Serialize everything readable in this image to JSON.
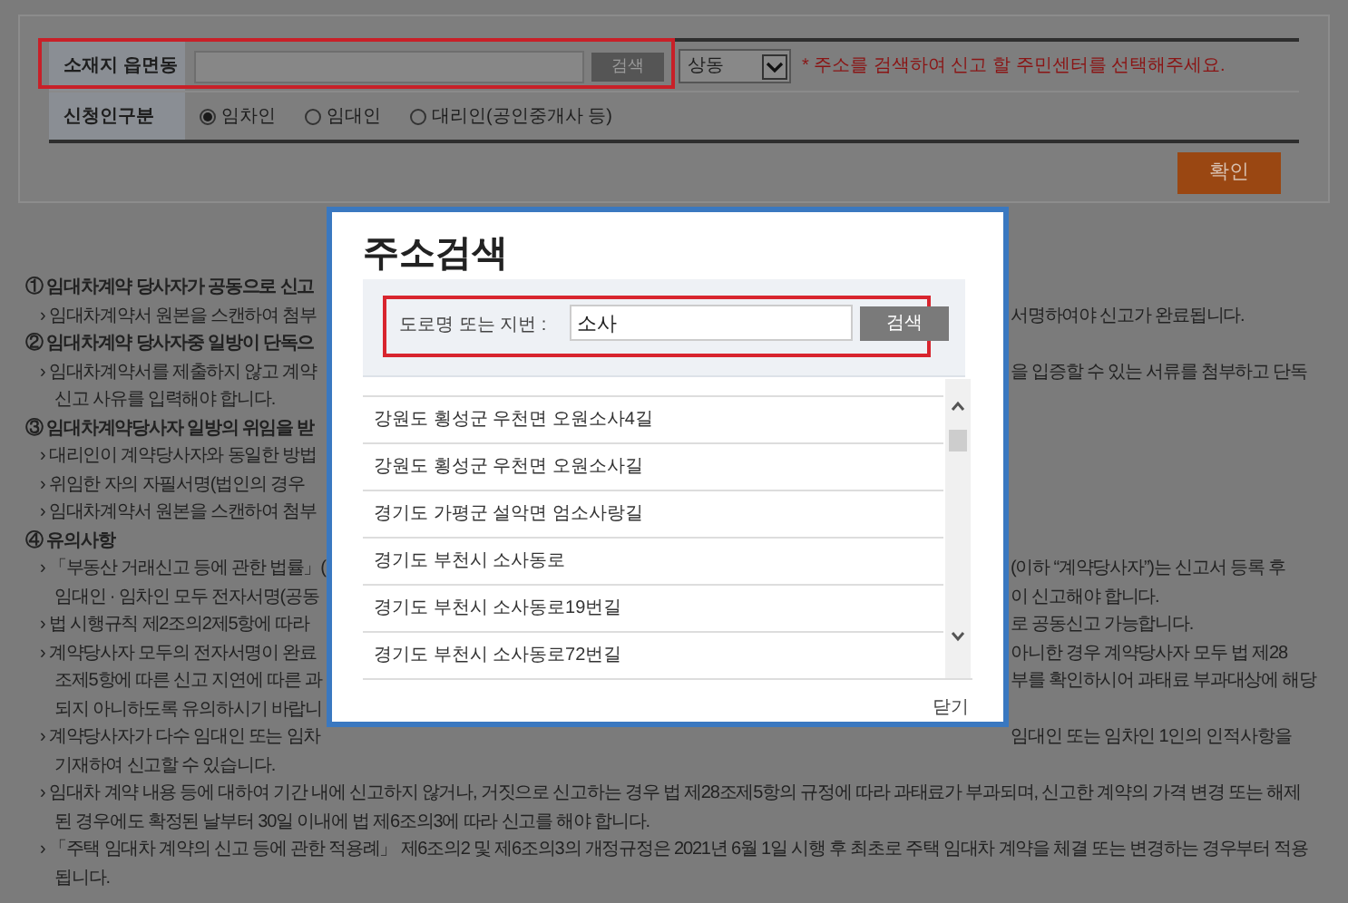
{
  "form": {
    "rows": [
      {
        "kind": "search",
        "label": "소재지 읍면동",
        "value": "",
        "button": "검색",
        "select": "상동",
        "note": "* 주소를 검색하여 신고 할 주민센터를 선택해주세요."
      },
      {
        "kind": "radio",
        "label": "신청인구분",
        "options": [
          {
            "label": "임차인",
            "selected": true
          },
          {
            "label": "임대인",
            "selected": false
          },
          {
            "label": "대리인(공인중개사 등)",
            "selected": false
          }
        ]
      }
    ],
    "confirm": "확인"
  },
  "notes": [
    {
      "kind": "heading",
      "left": "① 임대차계약 당사자가 공동으로 신고"
    },
    {
      "kind": "bullet",
      "left": "› 임대차계약서 원본을 스캔하여 첨부",
      "right": "서명하여야 신고가 완료됩니다."
    },
    {
      "kind": "heading",
      "left": "② 임대차계약 당사자중 일방이 단독으"
    },
    {
      "kind": "bullet",
      "left": "› 임대차계약서를 제출하지 않고 계약",
      "right": "을 입증할 수 있는 서류를 첨부하고 단독"
    },
    {
      "kind": "cont",
      "left": "신고 사유를 입력해야 합니다."
    },
    {
      "kind": "heading",
      "left": "③ 임대차계약당사자 일방의 위임을 받"
    },
    {
      "kind": "bullet",
      "left": "› 대리인이 계약당사자와 동일한 방법"
    },
    {
      "kind": "bullet",
      "left": "› 위임한 자의 자필서명(법인의 경우"
    },
    {
      "kind": "bullet",
      "left": "› 임대차계약서 원본을 스캔하여 첨부"
    },
    {
      "kind": "heading",
      "left": "④ 유의사항"
    },
    {
      "kind": "bullet",
      "left": "› 「부동산 거래신고 등에 관한 법률」(",
      "right": "(이하 “계약당사자”)는 신고서 등록 후"
    },
    {
      "kind": "cont",
      "left": "임대인 · 임차인 모두 전자서명(공동",
      "right": "이 신고해야 합니다."
    },
    {
      "kind": "bullet",
      "left": "› 법 시행규칙 제2조의2제5항에 따라",
      "right": "로 공동신고 가능합니다."
    },
    {
      "kind": "bullet",
      "left": "› 계약당사자 모두의 전자서명이 완료",
      "right": "아니한 경우 계약당사자 모두 법 제28"
    },
    {
      "kind": "cont",
      "left": "조제5항에 따른 신고 지연에 따른 과",
      "right": "부를 확인하시어 과태료 부과대상에 해당"
    },
    {
      "kind": "cont",
      "left": "되지 아니하도록 유의하시기 바랍니"
    },
    {
      "kind": "bullet",
      "left": "› 계약당사자가 다수 임대인 또는 임차",
      "right": "임대인 또는 임차인 1인의 인적사항을"
    },
    {
      "kind": "cont",
      "left": "기재하여 신고할 수 있습니다."
    },
    {
      "kind": "bullet",
      "left": "› 임대차 계약 내용 등에 대하여 기간 내에 신고하지 않거나, 거짓으로 신고하는 경우 법 제28조제5항의 규정에 따라 과태료가 부과되며, 신고한 계약의 가격 변경 또는 해제"
    },
    {
      "kind": "cont",
      "left": "된 경우에도 확정된 날부터 30일 이내에 법 제6조의3에 따라 신고를 해야 합니다."
    },
    {
      "kind": "bullet",
      "left": "› 「주택 임대차 계약의 신고 등에 관한 적용례」 제6조의2 및 제6조의3의 개정규정은 2021년 6월 1일 시행 후 최초로 주택 임대차 계약을 체결 또는 변경하는 경우부터 적용"
    },
    {
      "kind": "cont",
      "left": "됩니다."
    }
  ],
  "dialog": {
    "title": "주소검색",
    "search_label": "도로명 또는 지번 :",
    "search_value": "소사",
    "search_button": "검색",
    "results": [
      "강원도 횡성군 우천면 오원소사4길",
      "강원도 횡성군 우천면 오원소사길",
      "경기도 가평군 설악면 엄소사랑길",
      "경기도 부천시 소사동로",
      "경기도 부천시 소사동로19번길",
      "경기도 부천시 소사동로72번길"
    ],
    "close": "닫기"
  }
}
